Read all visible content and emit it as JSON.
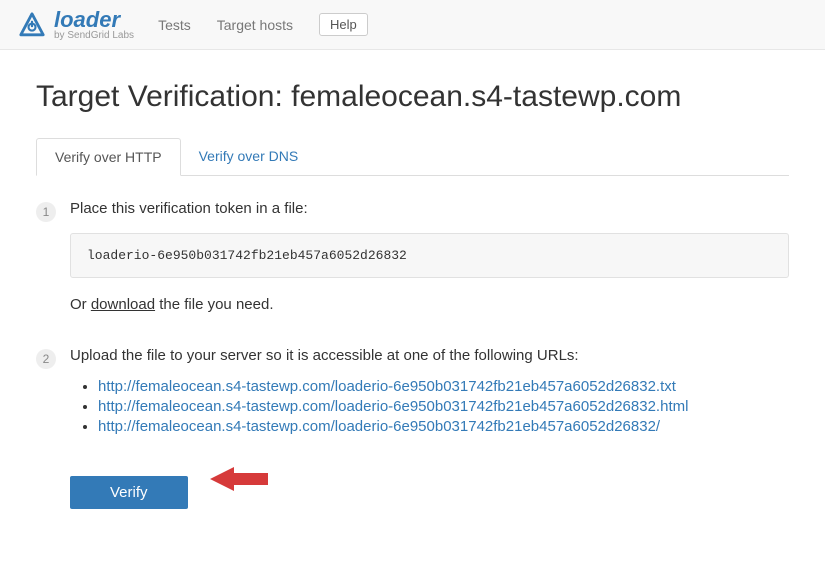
{
  "header": {
    "brand": "loader",
    "byline": "by SendGrid Labs",
    "nav": {
      "tests": "Tests",
      "target_hosts": "Target hosts"
    },
    "help": "Help"
  },
  "page": {
    "title": "Target Verification: femaleocean.s4-tastewp.com",
    "tabs": {
      "http": "Verify over HTTP",
      "dns": "Verify over DNS"
    },
    "step1": {
      "num": "1",
      "text": "Place this verification token in a file:",
      "token": "loaderio-6e950b031742fb21eb457a6052d26832",
      "or_prefix": "Or ",
      "download": "download",
      "or_suffix": " the file you need."
    },
    "step2": {
      "num": "2",
      "text": "Upload the file to your server so it is accessible at one of the following URLs:",
      "urls": [
        "http://femaleocean.s4-tastewp.com/loaderio-6e950b031742fb21eb457a6052d26832.txt",
        "http://femaleocean.s4-tastewp.com/loaderio-6e950b031742fb21eb457a6052d26832.html",
        "http://femaleocean.s4-tastewp.com/loaderio-6e950b031742fb21eb457a6052d26832/"
      ]
    },
    "verify": "Verify"
  }
}
